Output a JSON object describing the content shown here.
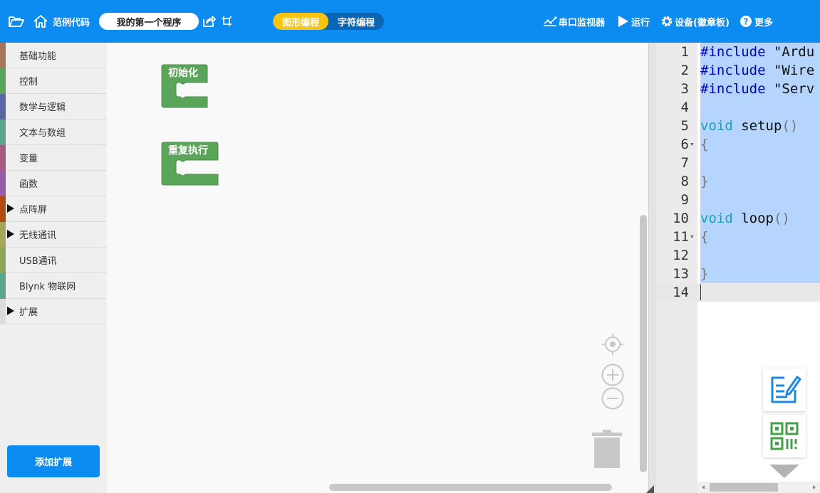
{
  "topbar": {
    "examples_label": "范例代码",
    "project_name": "我的第一个程序",
    "mode_graphic": "图形编程",
    "mode_text": "字符编程",
    "serial_monitor_label": "串口监视器",
    "run_label": "运行",
    "device_label": "设备(徽章板)",
    "more_label": "更多",
    "accent_color": "#f7c413",
    "bar_color": "#0c8cf0"
  },
  "sidebar": {
    "categories": [
      {
        "label": "基础功能",
        "color": "#a5745b",
        "expandable": false
      },
      {
        "label": "控制",
        "color": "#5ba55b",
        "expandable": false
      },
      {
        "label": "数学与逻辑",
        "color": "#5b67a5",
        "expandable": false
      },
      {
        "label": "文本与数组",
        "color": "#5ba58c",
        "expandable": false
      },
      {
        "label": "变量",
        "color": "#a55b80",
        "expandable": false
      },
      {
        "label": "函数",
        "color": "#995ba5",
        "expandable": false
      },
      {
        "label": "点阵屏",
        "color": "#b34a0e",
        "expandable": true
      },
      {
        "label": "无线通讯",
        "color": "#a5a55b",
        "expandable": true
      },
      {
        "label": "USB通讯",
        "color": "#8ca55b",
        "expandable": false
      },
      {
        "label": "Blynk 物联网",
        "color": "#5ba58c",
        "expandable": false
      },
      {
        "label": "扩展",
        "color": "#dcdcdc",
        "expandable": true
      }
    ],
    "add_extension_label": "添加扩展"
  },
  "workspace": {
    "blocks": [
      {
        "label": "初始化",
        "color": "#5ba55b"
      },
      {
        "label": "重复执行",
        "color": "#5ba55b"
      }
    ]
  },
  "editor": {
    "lines": [
      {
        "n": "1",
        "parts": [
          [
            "kw-dir",
            "#include"
          ],
          [
            "pl",
            " \"Ardu"
          ]
        ]
      },
      {
        "n": "2",
        "parts": [
          [
            "kw-dir",
            "#include"
          ],
          [
            "pl",
            " \"Wire"
          ]
        ]
      },
      {
        "n": "3",
        "parts": [
          [
            "kw-dir",
            "#include"
          ],
          [
            "pl",
            " \"Serv"
          ]
        ]
      },
      {
        "n": "4",
        "parts": []
      },
      {
        "n": "5",
        "parts": [
          [
            "kw-type",
            "void"
          ],
          [
            "pl",
            " setup"
          ],
          [
            "paren",
            "()"
          ]
        ]
      },
      {
        "n": "6",
        "fold": true,
        "parts": [
          [
            "paren",
            "{"
          ]
        ]
      },
      {
        "n": "7",
        "parts": []
      },
      {
        "n": "8",
        "parts": [
          [
            "paren",
            "}"
          ]
        ]
      },
      {
        "n": "9",
        "parts": []
      },
      {
        "n": "10",
        "parts": [
          [
            "kw-type",
            "void"
          ],
          [
            "pl",
            " loop"
          ],
          [
            "paren",
            "()"
          ]
        ]
      },
      {
        "n": "11",
        "fold": true,
        "parts": [
          [
            "paren",
            "{"
          ]
        ]
      },
      {
        "n": "12",
        "parts": []
      },
      {
        "n": "13",
        "parts": [
          [
            "paren",
            "}"
          ]
        ]
      },
      {
        "n": "14",
        "parts": []
      }
    ],
    "selection_color": "#b5d5ff"
  }
}
